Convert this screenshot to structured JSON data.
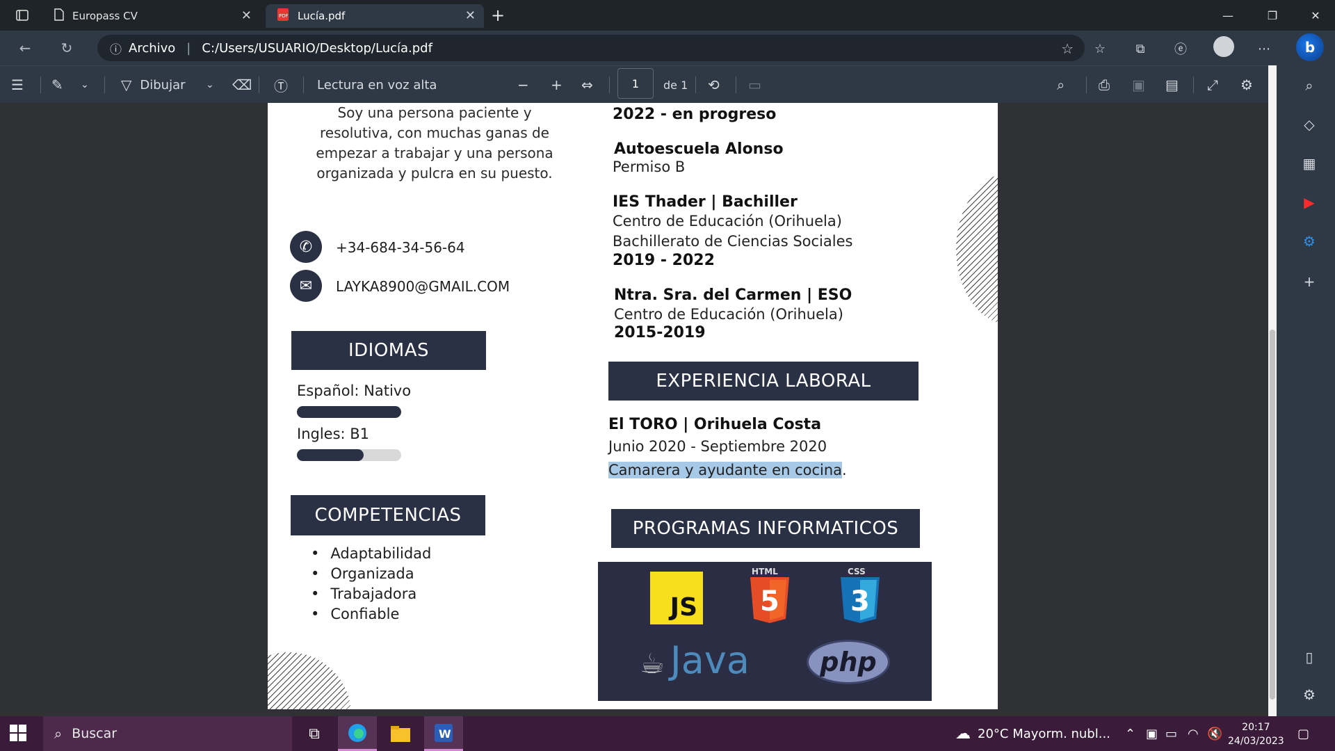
{
  "browser": {
    "tabs": [
      {
        "label": "Europass CV",
        "active": false,
        "icon": "page-icon"
      },
      {
        "label": "Lucía.pdf",
        "active": true,
        "icon": "pdf-icon"
      }
    ],
    "address": {
      "scheme_label": "Archivo",
      "url": "C:/Users/USUARIO/Desktop/Lucía.pdf"
    }
  },
  "pdf_toolbar": {
    "draw_label": "Dibujar",
    "read_aloud_label": "Lectura en voz alta",
    "page_number": "1",
    "page_total_label": "de 1"
  },
  "document": {
    "profile_text": "Soy una persona paciente y resolutiva, con muchas ganas de empezar a trabajar y una persona organizada y pulcra en su puesto.",
    "phone": "+34-684-34-56-64",
    "email": "LAYKA8900@GMAIL.COM",
    "languages_heading": "IDIOMAS",
    "languages": [
      {
        "label": "Español:  Nativo",
        "level": 1.0
      },
      {
        "label": "Ingles: B1",
        "level": 0.64
      }
    ],
    "skills_heading": "COMPETENCIAS",
    "skills": [
      "Adaptabilidad",
      "Organizada",
      "Trabajadora",
      "Confiable"
    ],
    "education": {
      "first_period": "2022 - en progreso",
      "entries": [
        {
          "title": "Autoescuela Alonso",
          "lines": [
            "Permiso B"
          ],
          "period": ""
        },
        {
          "title": "IES Thader | Bachiller",
          "lines": [
            "Centro de Educación (Orihuela)",
            "Bachillerato de Ciencias Sociales"
          ],
          "period": "2019 - 2022"
        },
        {
          "title": "Ntra. Sra. del Carmen | ESO",
          "lines": [
            "Centro de Educación (Orihuela)"
          ],
          "period": "2015-2019"
        }
      ]
    },
    "experience_heading": "EXPERIENCIA LABORAL",
    "experience": {
      "title": "El TORO | Orihuela Costa",
      "period": "Junio 2020 - Septiembre 2020",
      "role": "Camarera y ayudante en cocina",
      "role_suffix": "."
    },
    "programs_heading": "PROGRAMAS INFORMATICOS",
    "program_logos": {
      "js": "JS",
      "html": "HTML",
      "css": "CSS",
      "java": "Java",
      "php": "php"
    }
  },
  "taskbar": {
    "search_placeholder": "Buscar",
    "weather": "20°C  Mayorm. nubl...",
    "time": "20:17",
    "date": "24/03/2023"
  },
  "colors": {
    "navy_heading": "#2b3145",
    "highlight": "#a7c9e8",
    "taskbar": "#3a1c3a",
    "toolbar": "#2f3945"
  }
}
